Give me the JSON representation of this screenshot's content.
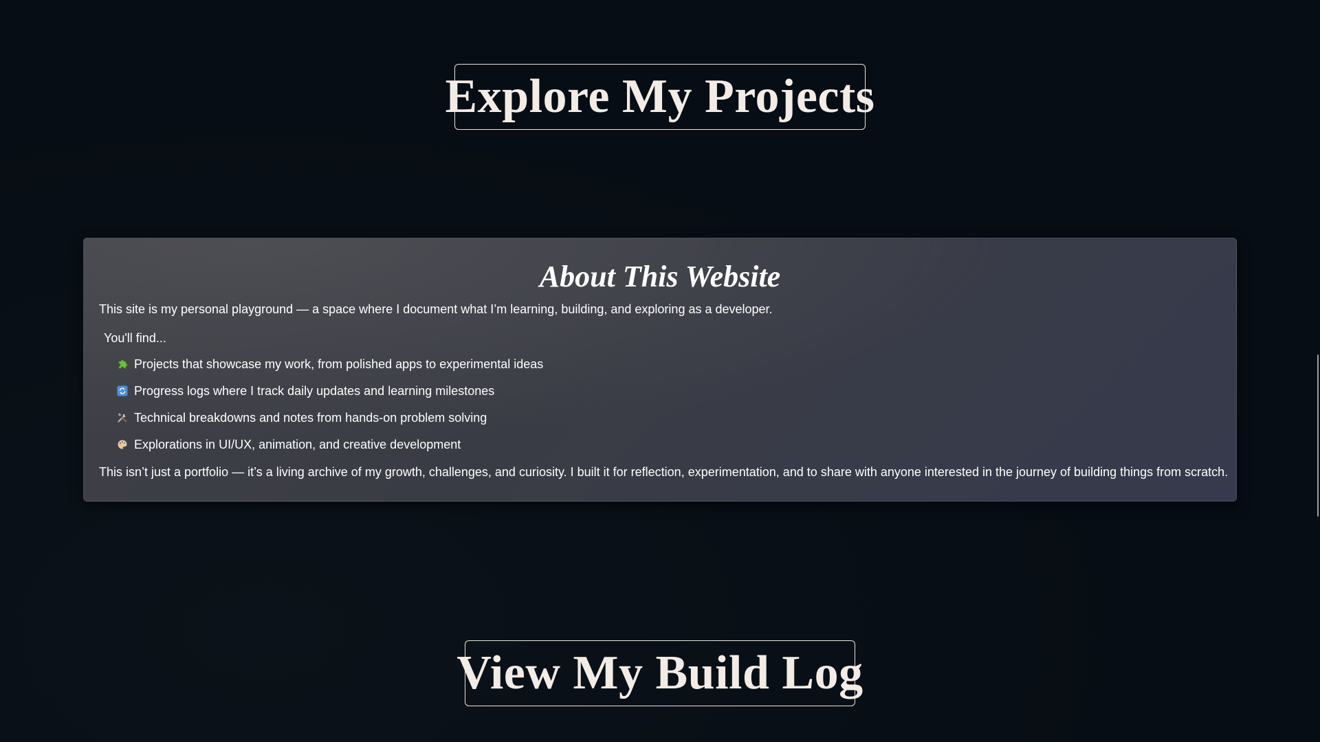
{
  "buttons": {
    "projects_label": "Explore My Projects",
    "buildlog_label": "View My Build Log"
  },
  "about": {
    "title": "About This Website",
    "intro": "This site is my personal playground — a space where I document what I’m learning, building, and exploring as a developer.",
    "find_label": "You'll find...",
    "items": [
      {
        "icon": "puzzle-piece-icon",
        "text": "Projects that showcase my work, from polished apps to experimental ideas"
      },
      {
        "icon": "refresh-icon",
        "text": "Progress logs where I track daily updates and learning milestones"
      },
      {
        "icon": "tools-icon",
        "text": "Technical breakdowns and notes from hands-on problem solving"
      },
      {
        "icon": "palette-icon",
        "text": "Explorations in UI/UX, animation, and creative development"
      }
    ],
    "outro": "This isn’t just a portfolio — it’s a living archive of my growth, challenges, and curiosity. I built it for reflection, experimentation, and to share with anyone interested in the journey of building things from scratch."
  },
  "colors": {
    "background": "#070d14",
    "card": "#3c3e47",
    "button_text": "#f3ece6",
    "button_border": "#e8e6e2"
  }
}
